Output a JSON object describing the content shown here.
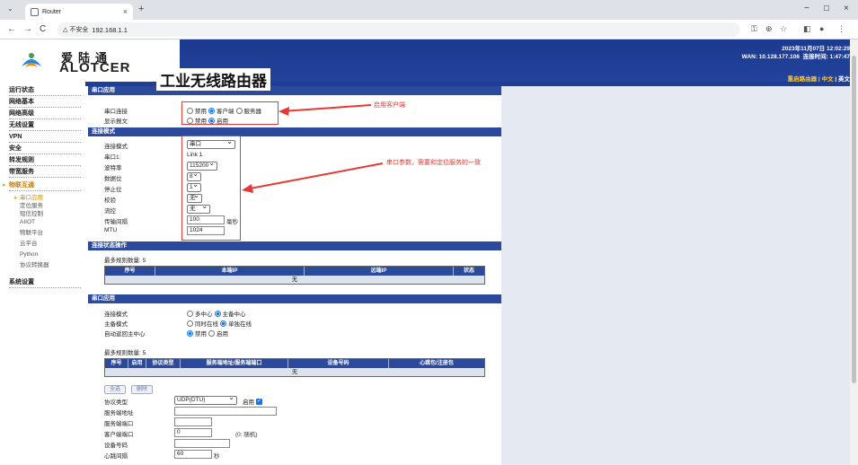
{
  "browser": {
    "tab_title": "Router",
    "tab_close": "×",
    "new_tab": "+",
    "security_label": "△ 不安全",
    "url": "192.168.1.1",
    "back": "←",
    "forward": "→",
    "reload": "C",
    "minimize": "−",
    "maximize": "□",
    "close": "×"
  },
  "header": {
    "brand_cn": "爱陆通",
    "brand_en": "ALOTCER",
    "product": "工业无线路由器",
    "datetime": "2023年11月07日 12:02:29",
    "wan": "WAN: 10.128.177.106",
    "uptime": "连接时间: 1:47:47",
    "lang_cn": "中文",
    "lang_sep": " | ",
    "lang_en": "英文",
    "lang_prefix": "重启路由器 | "
  },
  "sidebar": {
    "items": [
      "运行状态",
      "网络基本",
      "网络高级",
      "无线设置",
      "VPN",
      "安全",
      "转发规则",
      "带宽服务",
      "物联互通",
      "系统设置"
    ],
    "active": "物联互通",
    "sub_items": [
      "串口应用",
      "定位服务",
      "短信控制",
      "AIIOT",
      "物联平台",
      "云平台",
      "Python",
      "协议转换器"
    ],
    "current_sub": "串口应用"
  },
  "serial": {
    "section_title": "串口应用",
    "conn_label": "串口连接",
    "conn_options": [
      "禁用",
      "客户端",
      "服务器"
    ],
    "show_label": "显示报文",
    "show_options": [
      "禁用",
      "启用"
    ]
  },
  "conn_mode": {
    "section_title": "连接模式",
    "mode_label": "连接模式",
    "mode_value": "串口",
    "port_label": "串口1:",
    "port_value": "Link 1",
    "baud_label": "波特率",
    "baud_value": "115200",
    "databits_label": "数据位",
    "databits_value": "8",
    "stopbits_label": "停止位",
    "stopbits_value": "1",
    "parity_label": "校验",
    "parity_value": "无",
    "flow_label": "流控",
    "flow_value": "无",
    "interval_label": "传输间隔",
    "interval_value": "100",
    "interval_unit": "毫秒",
    "mtu_label": "MTU",
    "mtu_value": "1024"
  },
  "conn_ops": {
    "section_title": "连接状态操作",
    "max_rules": "最多规则数量: 5",
    "columns": [
      "序号",
      "本端IP",
      "远端IP",
      "状态"
    ],
    "empty": "无"
  },
  "serial_app": {
    "section_title": "串口应用",
    "conn_mode_label": "连接模式",
    "conn_mode_options": [
      "多中心",
      "主备中心"
    ],
    "master_label": "主备模式",
    "master_options": [
      "同时在线",
      "单独在线"
    ],
    "auto_label": "自动返回主中心",
    "auto_options": [
      "禁用",
      "启用"
    ],
    "max_rules": "最多规则数量: 5",
    "columns": [
      "序号",
      "启用",
      "协议类型",
      "服务端地址/服务端端口",
      "设备号码",
      "心跳包/注册包"
    ],
    "empty": "无",
    "btn_all": "全选",
    "btn_delete": "删除",
    "proto_label": "协议类型",
    "proto_value": "UDP(DTU)",
    "enable_label": "启用",
    "server_addr_label": "服务端地址",
    "server_port_label": "服务端端口",
    "client_port_label": "客户端端口",
    "client_port_value": "0",
    "client_port_hint": "(0: 随机)",
    "device_label": "设备号码",
    "heartbeat_label": "心跳间隔",
    "heartbeat_value": "60",
    "heartbeat_unit": "秒"
  },
  "annotations": {
    "note1": "启用客户端",
    "note2": "串口参数，需要和定位服务的一致",
    "color": "#e53935"
  }
}
